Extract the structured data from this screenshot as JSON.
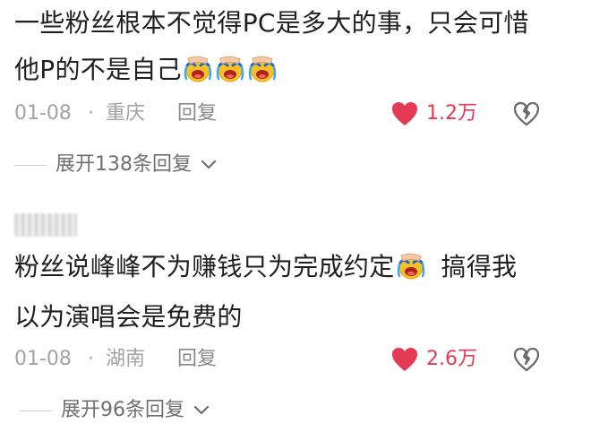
{
  "comments": [
    {
      "line1": "一些粉丝根本不觉得PC是多大的事，只会可惜",
      "line2": "他P的不是自己",
      "emojis": [
        "facepalm-cry-emoji",
        "facepalm-cry-emoji",
        "facepalm-cry-emoji"
      ],
      "date": "01-08",
      "dot": "·",
      "location": "重庆",
      "reply_label": "回复",
      "likes": "1.2万",
      "expand_label": "展开138条回复"
    },
    {
      "user": "",
      "line1": "粉丝说峰峰不为赚钱只为完成约定",
      "line1_tail": "搞得我",
      "line2": "以为演唱会是免费的",
      "emojis": [
        "facepalm-cry-emoji"
      ],
      "date": "01-08",
      "dot": "·",
      "location": "湖南",
      "reply_label": "回复",
      "likes": "2.6万",
      "expand_label": "展开96条回复"
    }
  ],
  "colors": {
    "like": "#e53a53",
    "meta": "#a3a3a3",
    "text": "#1f1f1f"
  }
}
